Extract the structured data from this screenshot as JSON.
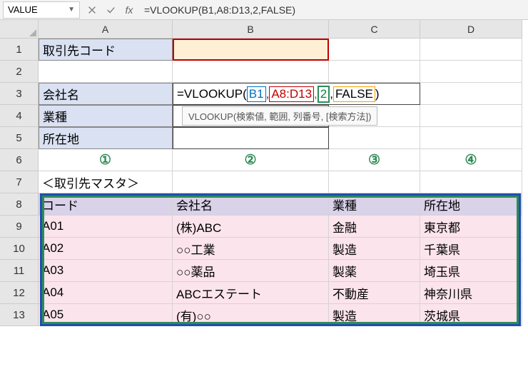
{
  "nameBox": "VALUE",
  "formulaBar": "=VLOOKUP(B1,A8:D13,2,FALSE)",
  "colHeaders": {
    "A": "A",
    "B": "B",
    "C": "C",
    "D": "D"
  },
  "rowHeaders": [
    "1",
    "2",
    "3",
    "4",
    "5",
    "6",
    "7",
    "8",
    "9",
    "10",
    "11",
    "12",
    "13"
  ],
  "labels": {
    "r1A": "取引先コード",
    "r3A": "会社名",
    "r4A": "業種",
    "r5A": "所在地",
    "r7A": "＜取引先マスタ＞"
  },
  "circled": {
    "c1": "①",
    "c2": "②",
    "c3": "③",
    "c4": "④"
  },
  "formulaCell": {
    "prefix": "=VLOOKUP(",
    "arg1": "B1",
    "comma1": ",",
    "arg2": "A8:D13",
    "comma2": ",",
    "arg3": "2",
    "comma3": ",",
    "arg4": "FALSE",
    "suffix": ")"
  },
  "tooltip": "VLOOKUP(検索値, 範囲, 列番号, [検索方法])",
  "tableHeader": {
    "code": "コード",
    "company": "会社名",
    "industry": "業種",
    "location": "所在地"
  },
  "tableRows": [
    {
      "code": "A01",
      "company": "(株)ABC",
      "industry": "金融",
      "location": "東京都"
    },
    {
      "code": "A02",
      "company": "○○工業",
      "industry": "製造",
      "location": "千葉県"
    },
    {
      "code": "A03",
      "company": "○○薬品",
      "industry": "製薬",
      "location": "埼玉県"
    },
    {
      "code": "A04",
      "company": "ABCエステート",
      "industry": "不動産",
      "location": "神奈川県"
    },
    {
      "code": "A05",
      "company": "(有)○○",
      "industry": "製造",
      "location": "茨城県"
    }
  ]
}
